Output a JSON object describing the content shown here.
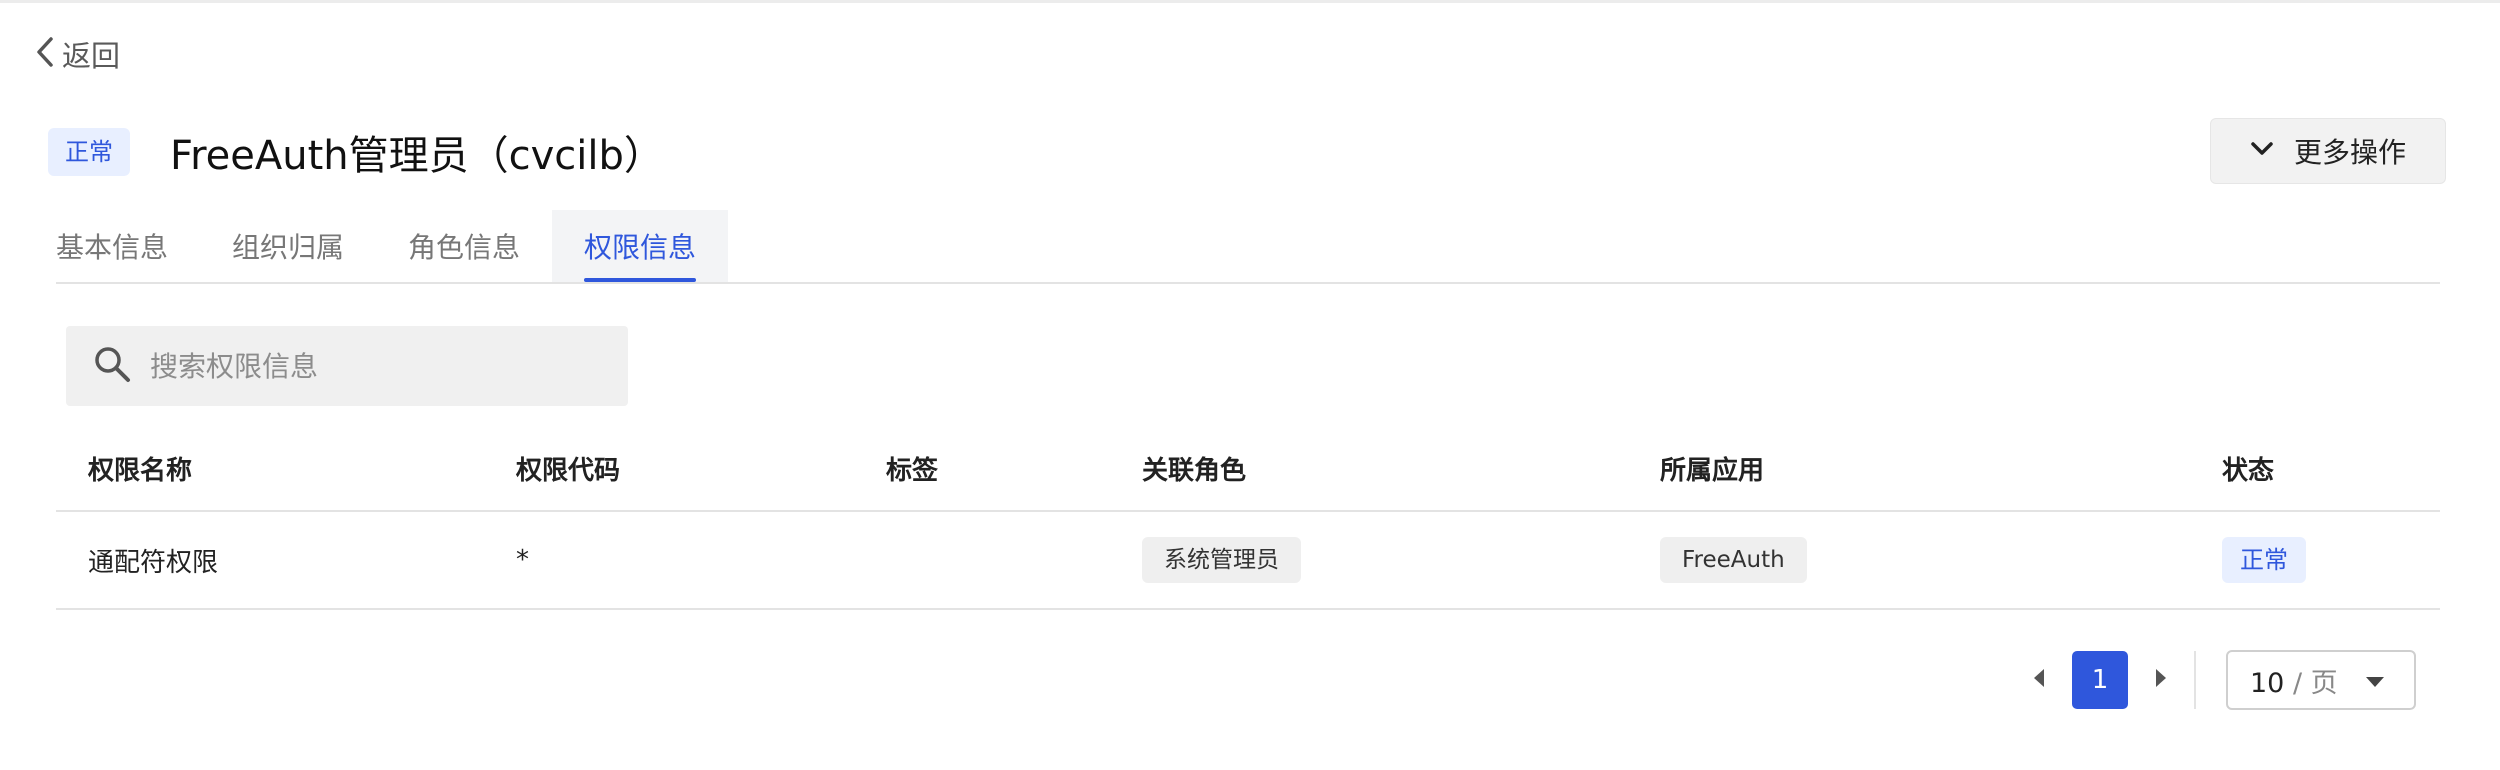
{
  "back": {
    "label": "返回",
    "icon": "chevron-left-icon"
  },
  "header": {
    "status": "正常",
    "title": "FreeAuth管理员（cvcilb）",
    "more_button": "更多操作",
    "more_icon": "chevron-down-icon"
  },
  "tabs": [
    {
      "label": "基本信息",
      "active": false
    },
    {
      "label": "组织归属",
      "active": false
    },
    {
      "label": "角色信息",
      "active": false
    },
    {
      "label": "权限信息",
      "active": true
    }
  ],
  "search": {
    "placeholder": "搜索权限信息",
    "value": "",
    "icon": "search-icon"
  },
  "table": {
    "columns": [
      "权限名称",
      "权限代码",
      "标签",
      "关联角色",
      "所属应用",
      "状态"
    ],
    "rows": [
      {
        "name": "通配符权限",
        "code": "*",
        "tag": "",
        "role": "系统管理员",
        "app": "FreeAuth",
        "status": "正常"
      }
    ]
  },
  "pagination": {
    "current_page": "1",
    "page_size": "10",
    "page_size_unit": "页",
    "page_size_separator": "/"
  },
  "colors": {
    "accent": "#2f57dc",
    "tag_bg": "#e8efff",
    "chip_bg": "#efefef"
  }
}
